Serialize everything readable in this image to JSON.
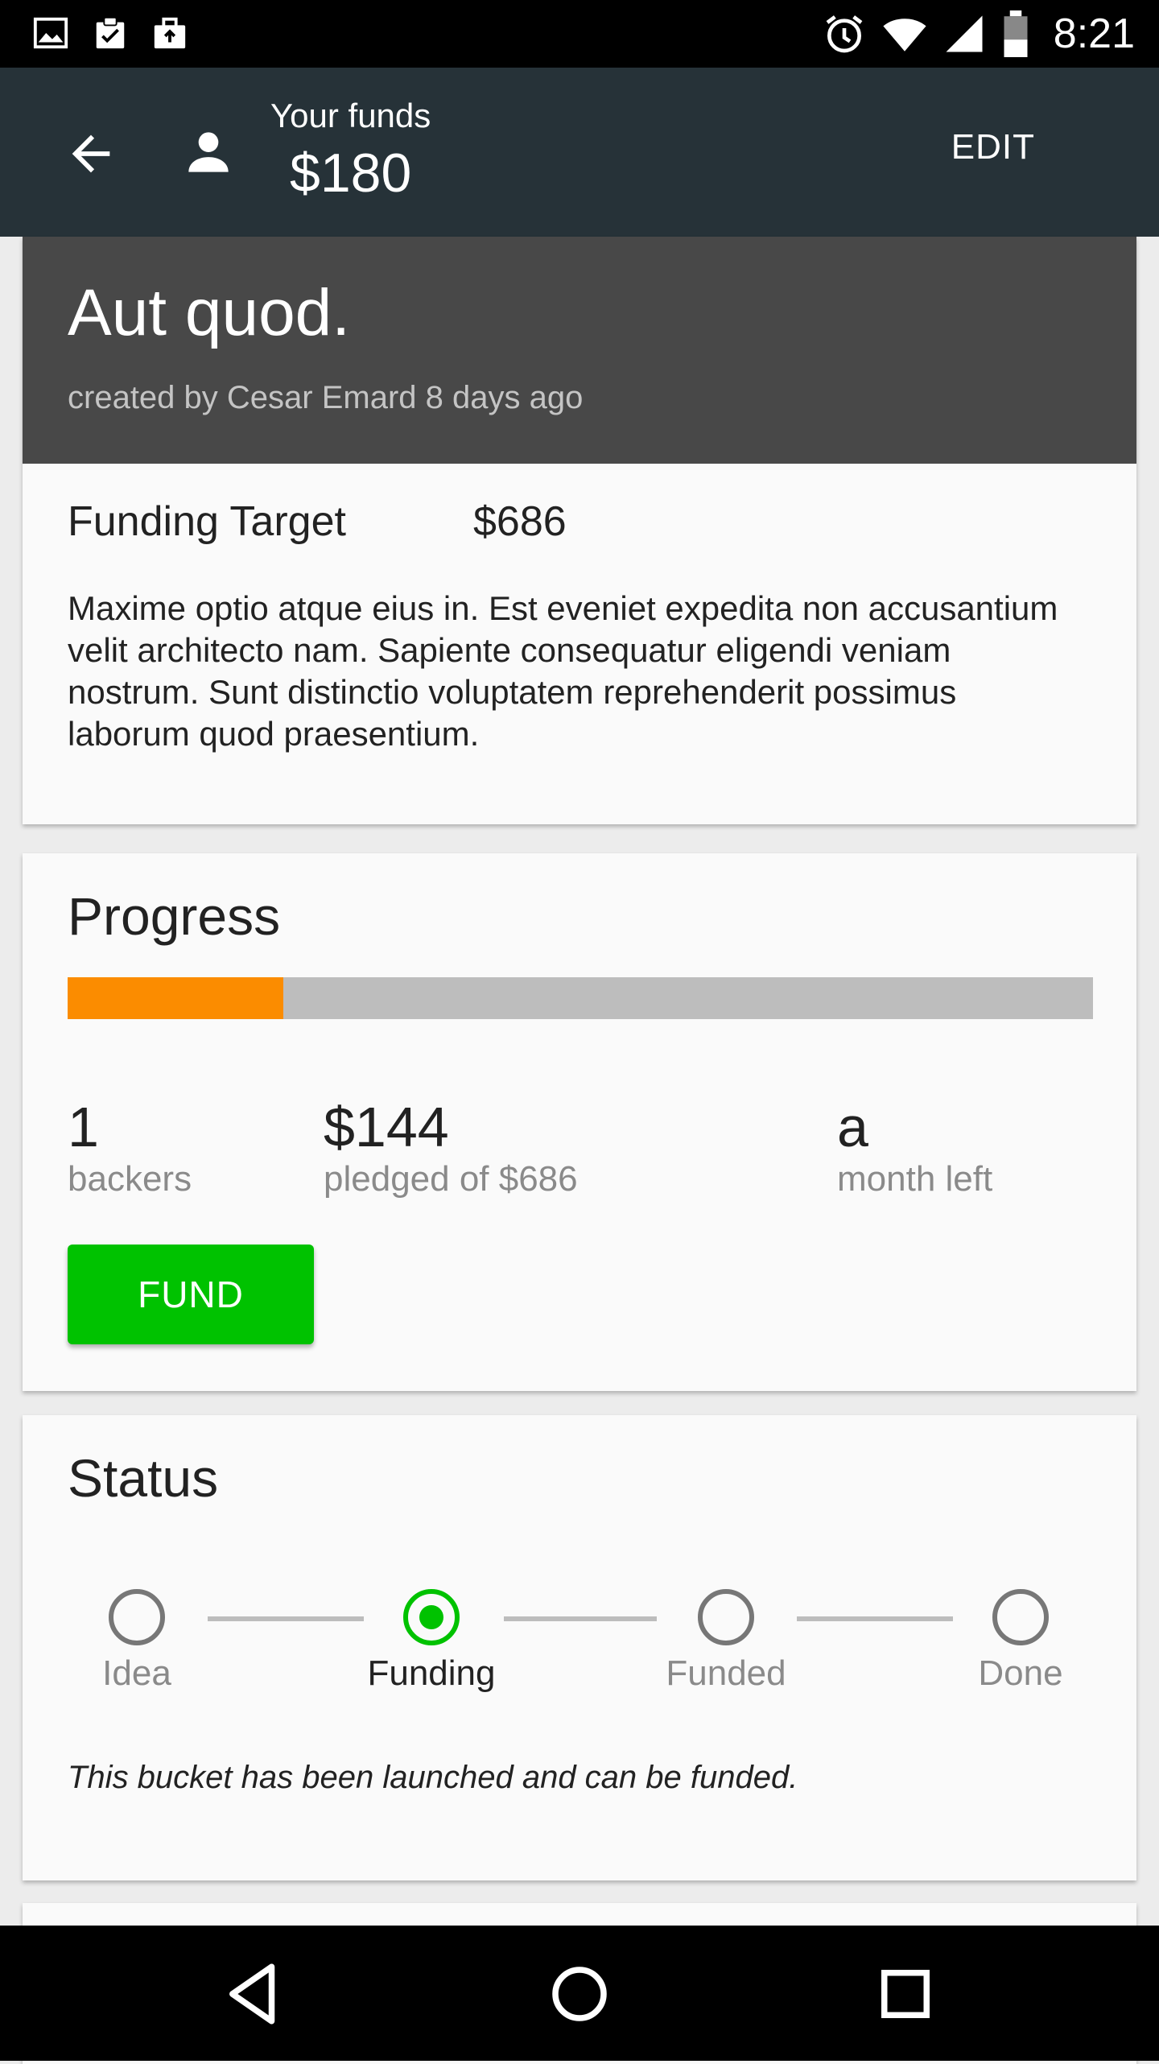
{
  "status_bar": {
    "time": "8:21",
    "icons": [
      "image-icon",
      "clipboard-check-icon",
      "briefcase-upload-icon",
      "alarm-icon",
      "wifi-icon",
      "signal-icon",
      "battery-icon"
    ]
  },
  "app_bar": {
    "back_icon": "arrow-back-icon",
    "person_icon": "person-icon",
    "funds_label": "Your funds",
    "funds_value": "$180",
    "edit_label": "EDIT"
  },
  "bucket": {
    "title": "Aut quod.",
    "subtitle": "created by Cesar Emard 8 days ago",
    "target_label": "Funding Target",
    "target_value": "$686",
    "description": "Maxime optio atque eius in. Est eveniet expedita non accusantium velit architecto nam. Sapiente consequatur eligendi veniam nostrum. Sunt distinctio voluptatem reprehenderit possimus laborum quod praesentium."
  },
  "progress": {
    "title": "Progress",
    "fraction": 0.21,
    "backers_count": "1",
    "backers_label": "backers",
    "pledged_value": "$144",
    "pledged_label": "pledged of $686",
    "time_value": "a",
    "time_label": "month left",
    "fund_button": "FUND",
    "colors": {
      "fill": "#fb8c00",
      "track": "#bdbdbd",
      "button": "#00c200"
    }
  },
  "status": {
    "title": "Status",
    "steps": [
      {
        "label": "Idea",
        "active": false
      },
      {
        "label": "Funding",
        "active": true
      },
      {
        "label": "Funded",
        "active": false
      },
      {
        "label": "Done",
        "active": false
      }
    ],
    "note": "This bucket has been launched and can be funded."
  },
  "nav_bar": {
    "icons": [
      "nav-back-icon",
      "nav-home-icon",
      "nav-recent-icon"
    ]
  },
  "colors": {
    "app_bar": "#263238",
    "card_header": "#484848",
    "active_step": "#00c200"
  }
}
